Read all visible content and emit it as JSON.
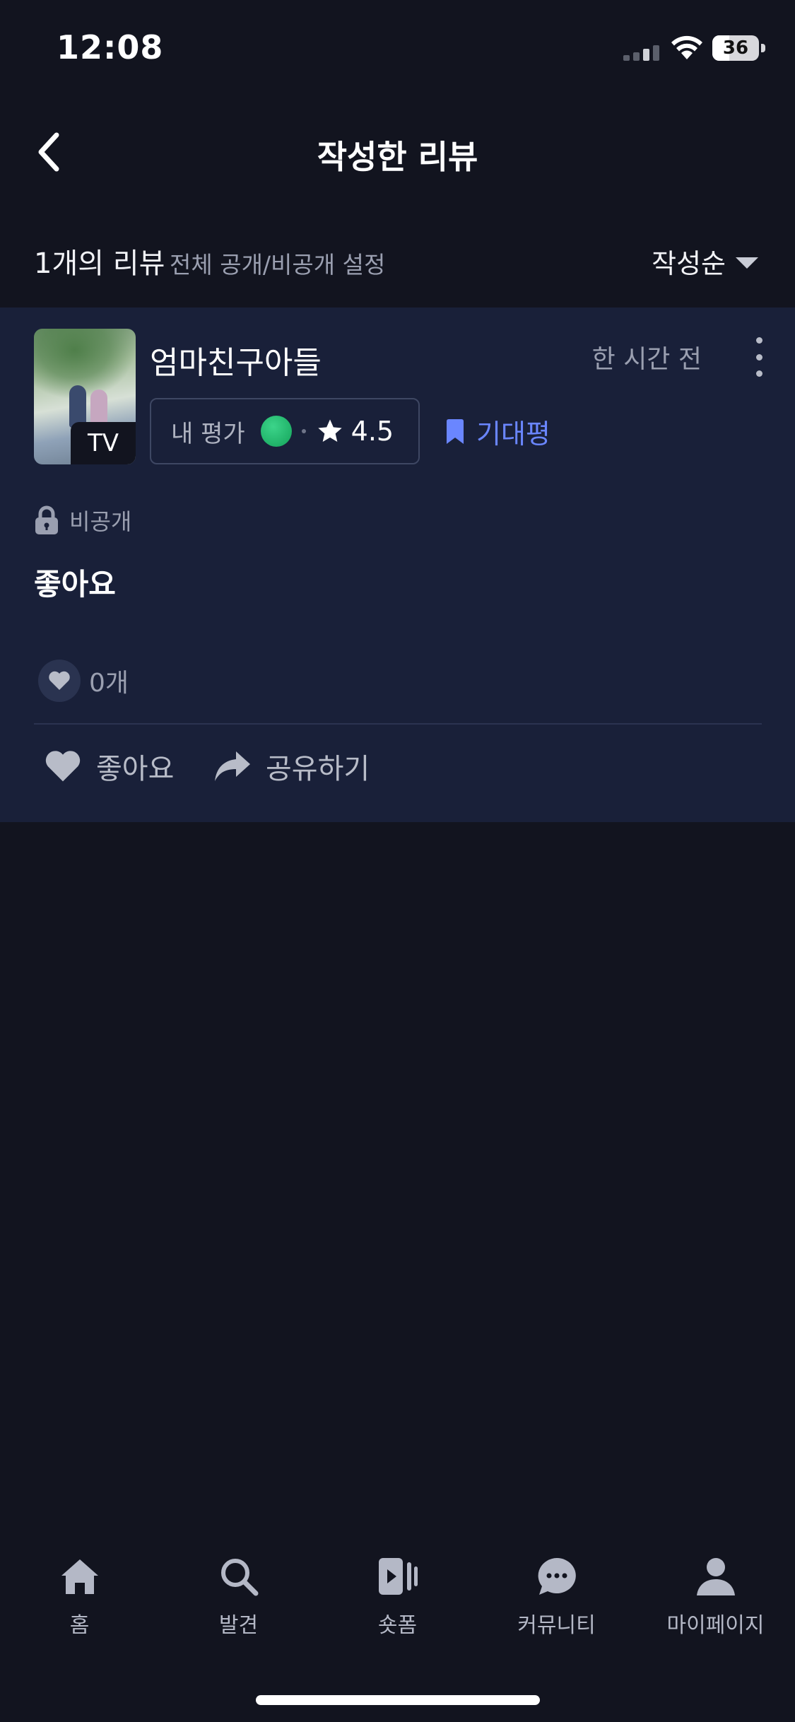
{
  "status_bar": {
    "time": "12:08",
    "battery": "36"
  },
  "header": {
    "title": "작성한 리뷰"
  },
  "summary": {
    "count_label": "1개의 리뷰",
    "visibility_setting": "전체 공개/비공개 설정",
    "sort_label": "작성순"
  },
  "review": {
    "poster_badge": "TV",
    "movie_title": "엄마친구아들",
    "time_ago": "한 시간 전",
    "rating_label": "내 평가",
    "rating_value": "4.5",
    "expectation_tag": "기대평",
    "visibility": "비공개",
    "text": "좋아요",
    "like_count": "0개",
    "like_button": "좋아요",
    "share_button": "공유하기"
  },
  "tabs": [
    {
      "label": "홈",
      "icon": "home-icon"
    },
    {
      "label": "발견",
      "icon": "search-icon"
    },
    {
      "label": "숏폼",
      "icon": "short-video-icon"
    },
    {
      "label": "커뮤니티",
      "icon": "chat-bubble-icon"
    },
    {
      "label": "마이페이지",
      "icon": "profile-icon"
    }
  ],
  "colors": {
    "background": "#12141f",
    "card": "#192039",
    "accent_blue": "#6a86ff",
    "rating_green": "#1fbf70"
  }
}
